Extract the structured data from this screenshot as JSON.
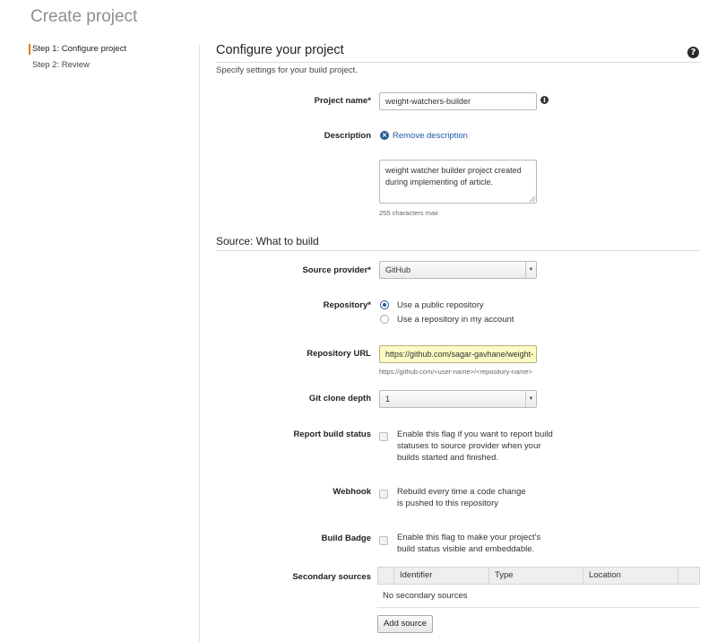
{
  "page": {
    "title": "Create project"
  },
  "steps": [
    {
      "label": "Step 1: Configure project",
      "active": true
    },
    {
      "label": "Step 2: Review",
      "active": false
    }
  ],
  "configure": {
    "heading": "Configure your project",
    "subtitle": "Specify settings for your build project.",
    "help_icon": "question-circle-icon",
    "project_name": {
      "label": "Project name*",
      "value": "weight-watchers-builder",
      "info_icon": "info-circle-icon"
    },
    "description": {
      "label": "Description",
      "remove_link": "Remove description",
      "remove_icon": "remove-circle-icon",
      "value": "weight watcher builder project created during implementing of article.",
      "hint": "255 characters max"
    }
  },
  "source": {
    "heading": "Source: What to build",
    "provider": {
      "label": "Source provider*",
      "value": "GitHub"
    },
    "repository": {
      "label": "Repository*",
      "options": [
        "Use a public repository",
        "Use a repository in my account"
      ],
      "selected": "Use a public repository"
    },
    "repo_url": {
      "label": "Repository URL",
      "value": "https://github.com/sagar-gavhane/weight-",
      "hint": "https://github.com/<user-name>/<repository-name>"
    },
    "clone_depth": {
      "label": "Git clone depth",
      "value": "1"
    },
    "report_status": {
      "label": "Report build status",
      "text": "Enable this flag if you want to report build statuses to source provider when your builds started and finished.",
      "checked": false
    },
    "webhook": {
      "label": "Webhook",
      "text": "Rebuild every time a code change is pushed to this repository",
      "checked": false
    },
    "badge": {
      "label": "Build Badge",
      "text": "Enable this flag to make your project's build status visible and embeddable.",
      "checked": false
    },
    "secondary": {
      "label": "Secondary sources",
      "columns": [
        "Identifier",
        "Type",
        "Location"
      ],
      "empty_text": "No secondary sources",
      "add_button": "Add source"
    }
  },
  "colors": {
    "accent": "#e07b12",
    "link": "#1f58a8",
    "url_bg": "#fbfbc3"
  }
}
